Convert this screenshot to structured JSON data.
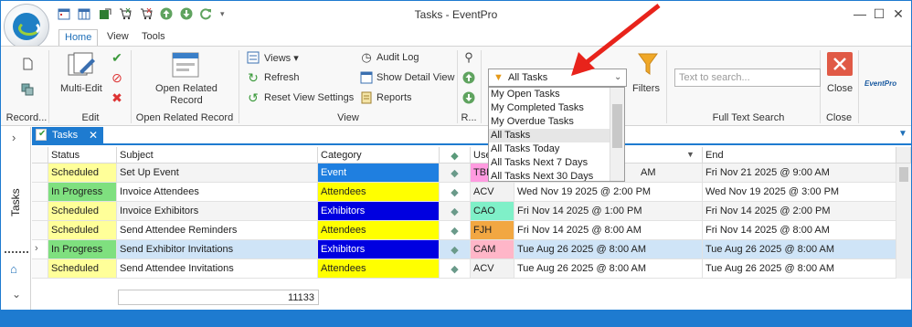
{
  "window": {
    "title": "Tasks - EventPro",
    "controls": [
      "minimize-icon",
      "maximize-icon",
      "close-icon"
    ]
  },
  "ribbon_tabs": [
    {
      "label": "Home",
      "active": true
    },
    {
      "label": "View",
      "active": false
    },
    {
      "label": "Tools",
      "active": false
    }
  ],
  "ribbon": {
    "record_group": "Record...",
    "edit_group": "Edit",
    "multi_edit": "Multi-Edit",
    "open_related_record": "Open Related Record",
    "open_related_group": "Open Related Record",
    "views": "Views",
    "refresh": "Refresh",
    "reset_view_settings": "Reset View Settings",
    "audit_log": "Audit Log",
    "show_detail_view": "Show Detail View",
    "reports": "Reports",
    "view_group": "View",
    "r_group": "R...",
    "filters": "Filters",
    "filter_selected": "All Tasks",
    "filter_options": [
      "My Open Tasks",
      "My Completed Tasks",
      "My Overdue Tasks",
      "All Tasks",
      "All Tasks Today",
      "All Tasks Next 7 Days",
      "All Tasks Next 30 Days"
    ],
    "search_placeholder": "Text to search...",
    "full_text_search_group": "Full Text Search",
    "close": "Close",
    "close_group": "Close",
    "brand": "EventPro"
  },
  "sidebar": {
    "label": "Tasks"
  },
  "doc_tab": {
    "label": "Tasks"
  },
  "grid": {
    "columns": [
      "Status",
      "Subject",
      "Category",
      "◆",
      "Use",
      "",
      "End"
    ],
    "rows": [
      {
        "status": "Scheduled",
        "subject": "Set Up Event",
        "category": "Event",
        "user": "TBI",
        "start": "",
        "end": "Fri Nov 21 2025 @ 9:00 AM"
      },
      {
        "status": "In Progress",
        "subject": "Invoice Attendees",
        "category": "Attendees",
        "user": "ACV",
        "start": "Wed Nov 19 2025 @ 2:00 PM",
        "end": "Wed Nov 19 2025 @ 3:00 PM"
      },
      {
        "status": "Scheduled",
        "subject": "Invoice Exhibitors",
        "category": "Exhibitors",
        "user": "CAO",
        "start": "Fri Nov 14 2025 @ 1:00 PM",
        "end": "Fri Nov 14 2025 @ 2:00 PM"
      },
      {
        "status": "Scheduled",
        "subject": "Send Attendee Reminders",
        "category": "Attendees",
        "user": "FJH",
        "start": "Fri Nov 14 2025 @ 8:00 AM",
        "end": "Fri Nov 14 2025 @ 8:00 AM"
      },
      {
        "status": "In Progress",
        "subject": "Send Exhibitor Invitations",
        "category": "Exhibitors",
        "user": "CAM",
        "start": "Tue Aug 26 2025 @ 8:00 AM",
        "end": "Tue Aug 26 2025 @ 8:00 AM"
      },
      {
        "status": "Scheduled",
        "subject": "Send Attendee Invitations",
        "category": "Attendees",
        "user": "ACV",
        "start": "Tue Aug 26 2025 @ 8:00 AM",
        "end": "Tue Aug 26 2025 @ 8:00 AM"
      }
    ],
    "partial_start_row0": "AM",
    "footer_count": "11133"
  },
  "colors": {
    "accent": "#1e7bd0",
    "scheduled": "#ffff99",
    "in_progress": "#7fe07f",
    "event": "#1f7fe0",
    "attendees": "#ffff00",
    "exhibitors": "#0000e0",
    "selected_row": "#cfe4f7",
    "arrow": "#e8231b"
  }
}
